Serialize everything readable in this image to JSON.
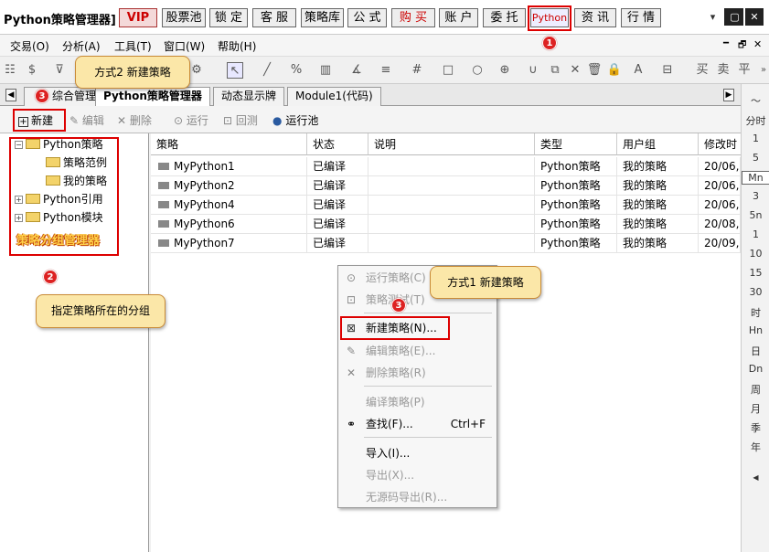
{
  "title_bar": {
    "app_title": "Python策略管理器]",
    "buttons": [
      "VIP",
      "股票池",
      "锁 定",
      "客 服",
      "策略库",
      "公 式",
      "购 买",
      "账 户",
      "委 托",
      "Python",
      "资 讯",
      "行 情"
    ],
    "window_controls": [
      "▾",
      "━",
      "▢",
      "✕"
    ]
  },
  "menu_bar": {
    "items": [
      "交易(O)",
      "分析(A)",
      "工具(T)",
      "窗口(W)",
      "帮助(H)"
    ],
    "mdi_controls": [
      "━",
      "🗗",
      "✕"
    ]
  },
  "tabs": {
    "items": [
      "综合管理",
      "Python策略管理器",
      "动态显示牌",
      "Module1(代码)"
    ],
    "active": "Python策略管理器"
  },
  "subtoolbar": {
    "new": "新建",
    "edit": "编辑",
    "delete": "删除",
    "run": "运行",
    "backtest": "回测",
    "run_pool": "运行池"
  },
  "tree": {
    "nodes": [
      {
        "label": "Python策略",
        "expander": "−"
      },
      {
        "label": "策略范例"
      },
      {
        "label": "我的策略"
      },
      {
        "label": "Python引用",
        "expander": "+"
      },
      {
        "label": "Python模块",
        "expander": "+"
      }
    ],
    "group_manager_label": "策略分组管理器"
  },
  "table": {
    "columns": [
      "策略",
      "状态",
      "说明",
      "类型",
      "用户组",
      "修改时"
    ],
    "rows": [
      {
        "name": "MyPython1",
        "status": "已编译",
        "desc": "",
        "type": "Python策略",
        "group": "我的策略",
        "modified": "20/06,"
      },
      {
        "name": "MyPython2",
        "status": "已编译",
        "desc": "",
        "type": "Python策略",
        "group": "我的策略",
        "modified": "20/06,"
      },
      {
        "name": "MyPython4",
        "status": "已编译",
        "desc": "",
        "type": "Python策略",
        "group": "我的策略",
        "modified": "20/06,"
      },
      {
        "name": "MyPython6",
        "status": "已编译",
        "desc": "",
        "type": "Python策略",
        "group": "我的策略",
        "modified": "20/08,"
      },
      {
        "name": "MyPython7",
        "status": "已编译",
        "desc": "",
        "type": "Python策略",
        "group": "我的策略",
        "modified": "20/09,"
      }
    ]
  },
  "context_menu": {
    "run": "运行策略(C)",
    "backtest": "策略测试(T)",
    "new": "新建策略(N)...",
    "edit": "编辑策略(E)...",
    "delete": "删除策略(R)",
    "compile": "编译策略(P)",
    "find": "查找(F)...",
    "find_shortcut": "Ctrl+F",
    "import": "导入(I)...",
    "export": "导出(X)...",
    "export_nosrc": "无源码导出(R)..."
  },
  "periods": [
    "分时",
    "1",
    "5",
    "Mn",
    "3",
    "5n",
    "1",
    "10",
    "15",
    "30",
    "时",
    "Hn",
    "日",
    "Dn",
    "周",
    "月",
    "季",
    "年"
  ],
  "annotations": {
    "callout_way2": "方式2 新建策略",
    "callout_way1": "方式1 新建策略",
    "callout_group": "指定策略所在的分组",
    "badge1": "1",
    "badge2": "2",
    "badge3a": "3",
    "badge3b": "3"
  },
  "colors": {
    "highlight_red": "#dd0000",
    "callout_bg": "#fbe7a8",
    "badge_red": "#dd2222",
    "group_label": "#ffd24a"
  }
}
